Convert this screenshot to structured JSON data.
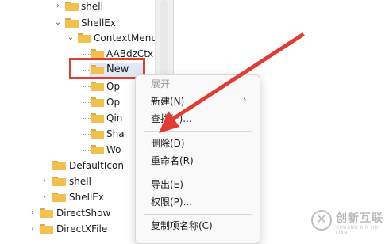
{
  "tree": {
    "rows": [
      {
        "label": "shell",
        "expander": "›"
      },
      {
        "label": "ShellEx",
        "expander": "⌄"
      },
      {
        "label": "ContextMenuHandlers",
        "expander": "⌄"
      },
      {
        "label": "AABdzCtx",
        "expander": ""
      },
      {
        "label": "New",
        "expander": ""
      },
      {
        "label": "Op",
        "expander": ""
      },
      {
        "label": "Op",
        "expander": ""
      },
      {
        "label": "Qin",
        "expander": ""
      },
      {
        "label": "Sha",
        "expander": ""
      },
      {
        "label": "Wo",
        "expander": ""
      },
      {
        "label": "DefaultIcon",
        "expander": ""
      },
      {
        "label": "shell",
        "expander": "›"
      },
      {
        "label": "ShellEx",
        "expander": "›"
      },
      {
        "label": "DirectShow",
        "expander": "›"
      },
      {
        "label": "DirectXFile",
        "expander": "›"
      }
    ]
  },
  "context_menu": {
    "header": "展开",
    "new_label": "新建(N)",
    "submenu_arrow": "›",
    "find_label": "查找(F)...",
    "delete_label": "删除(D)",
    "rename_label": "重命名(R)",
    "export_label": "导出(E)",
    "permissions_label": "权限(P)...",
    "copy_key_name_label": "复制项名称(C)"
  },
  "watermark": {
    "brand": "创新互联",
    "sub": "CHUANG XIN HU LIAN",
    "color": "#b9b9b9"
  },
  "annotation": {
    "highlight_color": "#e23c32",
    "arrow_color": "#e23c32"
  }
}
